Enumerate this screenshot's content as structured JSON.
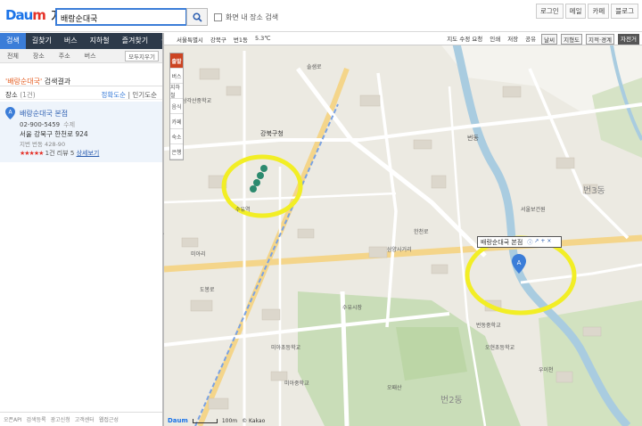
{
  "header": {
    "brand": "Daum",
    "brand_m": "m",
    "service": "지도",
    "search_value": "배랑순대국",
    "checkbox_label": "화면 내 장소 검색",
    "links": [
      "로그인",
      "메일",
      "카페",
      "블로그"
    ]
  },
  "nav": {
    "tabs": [
      "검색",
      "길찾기",
      "버스",
      "지하철",
      "즐겨찾기"
    ]
  },
  "filter": {
    "items": [
      "전체",
      "장소",
      "주소",
      "버스"
    ],
    "fold": "모두지우기"
  },
  "cats": [
    "전체",
    "장소",
    "주소",
    "버스"
  ],
  "result": {
    "title_q": "'배랑순대국'",
    "title_rest": " 검색결과",
    "section": "장소",
    "count": "(1건)",
    "sort_a": "정확도순",
    "sort_b": "인기도순",
    "name": "배랑순대국 본점",
    "phone": "02-900-5459",
    "phone_tag": "수제",
    "addr": "서울 강북구 한천로 924",
    "jibun": "지번 번동 428-90",
    "stars": "★★★★★",
    "rate": "1건",
    "review": "리뷰 5",
    "detail": "상세보기"
  },
  "footer": [
    "오픈API",
    "검색등록",
    "광고신청",
    "고객센터",
    "웹접근성"
  ],
  "map": {
    "bar_left": [
      "서울특별시",
      "강북구",
      "번1동",
      "5.3℃"
    ],
    "bar_right": [
      "지도 수정 요청",
      "인쇄",
      "저장",
      "공유",
      "날씨",
      "지형도",
      "지적·경계",
      "자전거"
    ],
    "tools": [
      "출발",
      "버스",
      "지하철",
      "음식",
      "카페",
      "숙소",
      "은행"
    ],
    "popup": "배랑순대국 본점",
    "pin": "A",
    "labels": [
      "삼각산중학교",
      "삼양사거리",
      "미아초등학교",
      "미아중학교",
      "도봉로",
      "솔샘로",
      "한천로",
      "우이천",
      "번동",
      "번2동",
      "번3동",
      "오패산",
      "강북구청",
      "서울보건원",
      "번동중학교",
      "오현초등학교",
      "미아리",
      "수유역",
      "수유시장"
    ],
    "copyright": "© Kakao",
    "scale": "100m"
  }
}
